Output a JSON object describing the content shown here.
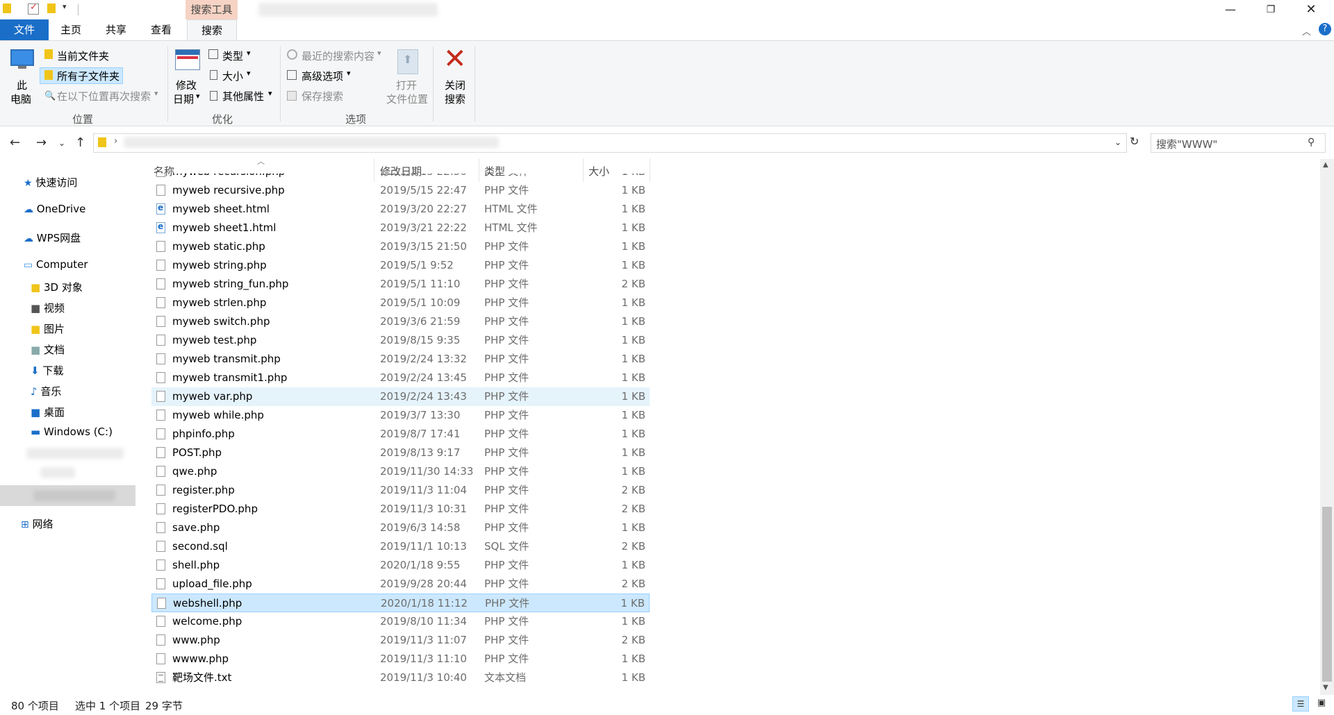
{
  "ribbon": {
    "context_header": "搜索工具",
    "tabs": [
      "文件",
      "主页",
      "共享",
      "查看",
      "搜索"
    ],
    "location": {
      "this_pc": [
        "此",
        "电脑"
      ],
      "current_folder": "当前文件夹",
      "all_subfolders": "所有子文件夹",
      "search_again": "在以下位置再次搜索",
      "group": "位置"
    },
    "refine": {
      "date_modified": [
        "修改",
        "日期"
      ],
      "type": "类型",
      "size": "大小",
      "other_props": "其他属性",
      "group": "优化"
    },
    "options": {
      "recent_searches": "最近的搜索内容",
      "advanced": "高级选项",
      "save_search": "保存搜索",
      "open_location": [
        "打开",
        "文件位置"
      ],
      "group": "选项"
    },
    "close_search": [
      "关闭",
      "搜索"
    ]
  },
  "search": {
    "placeholder": "搜索\"WWW\""
  },
  "nav": {
    "quick_access": "快速访问",
    "onedrive": "OneDrive",
    "wps": "WPS网盘",
    "computer": "Computer",
    "items": [
      "3D 对象",
      "视频",
      "图片",
      "文档",
      "下载",
      "音乐",
      "桌面"
    ],
    "drive": "Windows (C:)",
    "network": "网络"
  },
  "columns": {
    "name": "名称",
    "date": "修改日期",
    "type": "类型",
    "size": "大小"
  },
  "files": [
    {
      "name": "myweb recursion.php",
      "date": "2019/5/15 22:50",
      "type": "PHP 文件",
      "size": "1 KB",
      "icon": "php",
      "state": "partial"
    },
    {
      "name": "myweb recursive.php",
      "date": "2019/5/15 22:47",
      "type": "PHP 文件",
      "size": "1 KB",
      "icon": "php"
    },
    {
      "name": "myweb sheet.html",
      "date": "2019/3/20 22:27",
      "type": "HTML 文件",
      "size": "1 KB",
      "icon": "html"
    },
    {
      "name": "myweb sheet1.html",
      "date": "2019/3/21 22:22",
      "type": "HTML 文件",
      "size": "1 KB",
      "icon": "html"
    },
    {
      "name": "myweb static.php",
      "date": "2019/3/15 21:50",
      "type": "PHP 文件",
      "size": "1 KB",
      "icon": "php"
    },
    {
      "name": "myweb string.php",
      "date": "2019/5/1 9:52",
      "type": "PHP 文件",
      "size": "1 KB",
      "icon": "php"
    },
    {
      "name": "myweb string_fun.php",
      "date": "2019/5/1 11:10",
      "type": "PHP 文件",
      "size": "2 KB",
      "icon": "php"
    },
    {
      "name": "myweb strlen.php",
      "date": "2019/5/1 10:09",
      "type": "PHP 文件",
      "size": "1 KB",
      "icon": "php"
    },
    {
      "name": "myweb switch.php",
      "date": "2019/3/6 21:59",
      "type": "PHP 文件",
      "size": "1 KB",
      "icon": "php"
    },
    {
      "name": "myweb test.php",
      "date": "2019/8/15 9:35",
      "type": "PHP 文件",
      "size": "1 KB",
      "icon": "php"
    },
    {
      "name": "myweb transmit.php",
      "date": "2019/2/24 13:32",
      "type": "PHP 文件",
      "size": "1 KB",
      "icon": "php"
    },
    {
      "name": "myweb transmit1.php",
      "date": "2019/2/24 13:45",
      "type": "PHP 文件",
      "size": "1 KB",
      "icon": "php"
    },
    {
      "name": "myweb var.php",
      "date": "2019/2/24 13:43",
      "type": "PHP 文件",
      "size": "1 KB",
      "icon": "php",
      "state": "hover"
    },
    {
      "name": "myweb while.php",
      "date": "2019/3/7 13:30",
      "type": "PHP 文件",
      "size": "1 KB",
      "icon": "php"
    },
    {
      "name": "phpinfo.php",
      "date": "2019/8/7 17:41",
      "type": "PHP 文件",
      "size": "1 KB",
      "icon": "php"
    },
    {
      "name": "POST.php",
      "date": "2019/8/13 9:17",
      "type": "PHP 文件",
      "size": "1 KB",
      "icon": "php"
    },
    {
      "name": "qwe.php",
      "date": "2019/11/30 14:33",
      "type": "PHP 文件",
      "size": "1 KB",
      "icon": "php"
    },
    {
      "name": "register.php",
      "date": "2019/11/3 11:04",
      "type": "PHP 文件",
      "size": "2 KB",
      "icon": "php"
    },
    {
      "name": "registerPDO.php",
      "date": "2019/11/3 10:31",
      "type": "PHP 文件",
      "size": "2 KB",
      "icon": "php"
    },
    {
      "name": "save.php",
      "date": "2019/6/3 14:58",
      "type": "PHP 文件",
      "size": "1 KB",
      "icon": "php"
    },
    {
      "name": "second.sql",
      "date": "2019/11/1 10:13",
      "type": "SQL 文件",
      "size": "2 KB",
      "icon": "php"
    },
    {
      "name": "shell.php",
      "date": "2020/1/18 9:55",
      "type": "PHP 文件",
      "size": "1 KB",
      "icon": "php"
    },
    {
      "name": "upload_file.php",
      "date": "2019/9/28 20:44",
      "type": "PHP 文件",
      "size": "2 KB",
      "icon": "php"
    },
    {
      "name": "webshell.php",
      "date": "2020/1/18 11:12",
      "type": "PHP 文件",
      "size": "1 KB",
      "icon": "php",
      "state": "selected"
    },
    {
      "name": "welcome.php",
      "date": "2019/8/10 11:34",
      "type": "PHP 文件",
      "size": "1 KB",
      "icon": "php"
    },
    {
      "name": "www.php",
      "date": "2019/11/3 11:07",
      "type": "PHP 文件",
      "size": "2 KB",
      "icon": "php"
    },
    {
      "name": "wwww.php",
      "date": "2019/11/3 11:10",
      "type": "PHP 文件",
      "size": "1 KB",
      "icon": "php"
    },
    {
      "name": "靶场文件.txt",
      "date": "2019/11/3 10:40",
      "type": "文本文档",
      "size": "1 KB",
      "icon": "txt"
    }
  ],
  "status": {
    "count": "80 个项目",
    "selection": "选中 1 个项目",
    "bytes": "29 字节"
  },
  "colors": {
    "accent": "#1a6ec8",
    "selected": "#cce8ff",
    "hover": "#e5f3fb",
    "context": "#f6d3c4",
    "close_x": "#c42b1c"
  }
}
